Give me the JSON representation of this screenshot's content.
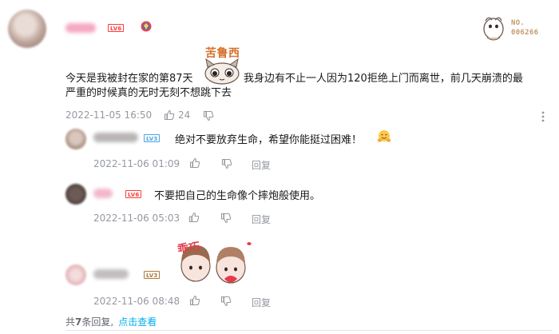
{
  "comment": {
    "level": "LV6",
    "text_line1": "今天是我被封在家的第87天",
    "text_line1_tail": "我身边有不止一人因为120拒绝上门而离世，前几天崩溃的最",
    "text_line2": "严重的时候真的无时无刻不想跳下去",
    "sticker_label": "苦鲁西",
    "timestamp": "2022-11-05 16:50",
    "likes": "24",
    "nameplate": {
      "line1": "NO.",
      "line2": "006266"
    }
  },
  "replies": [
    {
      "level": "LV3",
      "text": "绝对不要放弃生命，希望你能挺过困难！",
      "timestamp": "2022-11-06 01:09",
      "reply_label": "回复",
      "emoji": "hugging-face"
    },
    {
      "level": "LV6",
      "text": "不要把自己的生命像个摔炮般使用。",
      "timestamp": "2022-11-06 05:03",
      "reply_label": "回复"
    },
    {
      "level": "LV3",
      "text": "",
      "sticker_label": "乖巧",
      "timestamp": "2022-11-06 08:48",
      "reply_label": "回复"
    }
  ],
  "footer": {
    "prefix": "共",
    "count": "7",
    "suffix": "条回复,",
    "link": "点击查看"
  },
  "colors": {
    "link": "#00aeec",
    "meta": "#9499a0",
    "level_red": "#ff3b3b",
    "level_blue": "#4aa5e6"
  }
}
